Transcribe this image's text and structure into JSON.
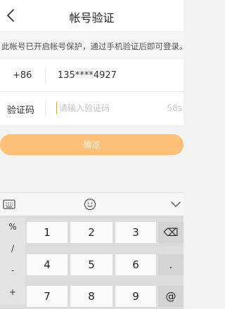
{
  "nav": {
    "title": "帐号验证"
  },
  "notice": {
    "text": "此帐号已开启帐号保护，通过手机验证后即可登录。"
  },
  "phone_row": {
    "country_code": "+86",
    "number": "135****4927"
  },
  "code_row": {
    "label": "验证码",
    "placeholder": "请输入验证码",
    "value": "",
    "countdown": "58s"
  },
  "confirm": {
    "label": "确定"
  },
  "colors": {
    "accent": "#ff9900",
    "confirm_bg": "#ffc079"
  },
  "keyboard": {
    "symbols": [
      "%",
      "/",
      "-",
      "+"
    ],
    "rows": [
      [
        "1",
        "2",
        "3",
        "⌫"
      ],
      [
        "4",
        "5",
        "6",
        "."
      ],
      [
        "7",
        "8",
        "9",
        "@"
      ]
    ]
  }
}
